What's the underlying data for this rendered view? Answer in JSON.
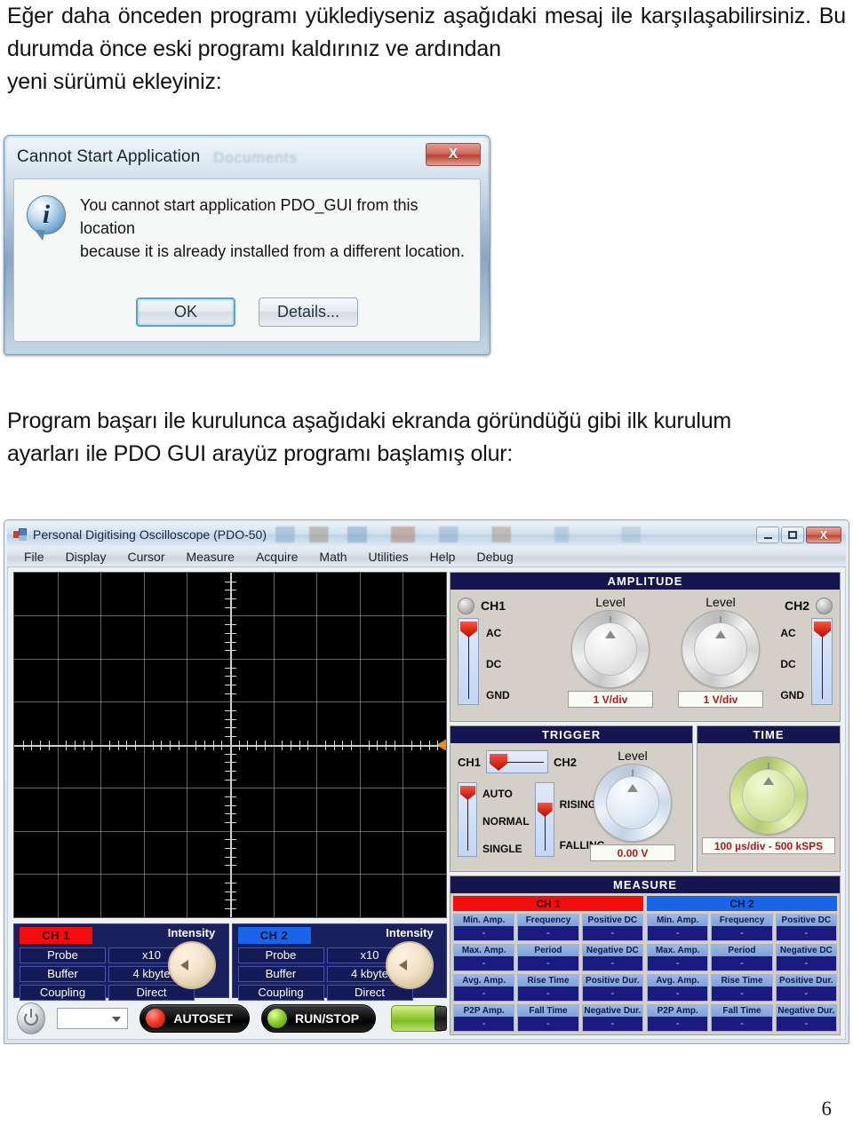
{
  "document": {
    "paragraph_1": "Eğer daha önceden programı yüklediyseniz aşağıdaki mesaj ile karşılaşabilirsiniz. Bu durumda önce eski programı kaldırınız ve ardından",
    "paragraph_1_last_line": "yeni sürümü ekleyiniz:",
    "paragraph_2": "Program başarı ile kurulunca aşağıdaki ekranda göründüğü gibi ilk kurulum",
    "paragraph_2_last_line": "ayarları ile  PDO GUI  arayüz programı başlamış olur:",
    "page_number": "6"
  },
  "error_dialog": {
    "title": "Cannot Start Application",
    "ghost_text": "Documents",
    "close_label": "X",
    "icon": "info-icon",
    "message_line_1": "You cannot start application PDO_GUI from this location",
    "message_line_2": "because it is already installed from a different location.",
    "ok_label": "OK",
    "details_label": "Details..."
  },
  "scope_window": {
    "title": "Personal Digitising Oscilloscope (PDO-50)",
    "window_buttons": {
      "minimize": "–",
      "maximize": "□",
      "close": "X"
    },
    "menu": [
      "File",
      "Display",
      "Cursor",
      "Measure",
      "Acquire",
      "Math",
      "Utilities",
      "Help",
      "Debug"
    ],
    "display": {
      "grid_columns": 10,
      "grid_rows": 8,
      "trigger_marker_color": "#f0891a",
      "background": "#000000"
    },
    "amplitude": {
      "title": "AMPLITUDE",
      "ch1_label": "CH1",
      "ch2_label": "CH2",
      "coupling_options": [
        "AC",
        "DC",
        "GND"
      ],
      "coupling_selected": "AC",
      "knob1_label": "Level",
      "knob2_label": "Level",
      "readout1": "1 V/div",
      "readout2": "1 V/div"
    },
    "trigger": {
      "title": "TRIGGER",
      "source_left": "CH1",
      "source_right": "CH2",
      "mode_options": [
        "AUTO",
        "NORMAL",
        "SINGLE"
      ],
      "mode_selected": "AUTO",
      "slope_options": [
        "RISING",
        "FALLING"
      ],
      "slope_selected": "RISING",
      "knob_label": "Level",
      "readout": "0.00 V"
    },
    "time": {
      "title": "TIME",
      "readout": "100 µs/div - 500 kSPS"
    },
    "measure": {
      "title": "MEASURE",
      "ch1_label": "CH 1",
      "ch2_label": "CH 2",
      "labels": [
        "Min. Amp.",
        "Frequency",
        "Positive DC",
        "Max. Amp.",
        "Period",
        "Negative DC",
        "Avg. Amp.",
        "Rise Time",
        "Positive Dur.",
        "P2P Amp.",
        "Fall Time",
        "Negative Dur."
      ],
      "ch1_values": [
        "-",
        "-",
        "-",
        "-",
        "-",
        "-",
        "-",
        "-",
        "-",
        "-",
        "-",
        "-"
      ],
      "ch2_values": [
        "-",
        "-",
        "-",
        "-",
        "-",
        "-",
        "-",
        "-",
        "-",
        "-",
        "-",
        "-"
      ]
    },
    "channels": [
      {
        "tag": "CH 1",
        "rows": [
          {
            "name": "Probe",
            "value": "x10"
          },
          {
            "name": "Buffer",
            "value": "4 kbyte"
          },
          {
            "name": "Coupling",
            "value": "Direct"
          }
        ],
        "intensity_label": "Intensity"
      },
      {
        "tag": "CH 2",
        "rows": [
          {
            "name": "Probe",
            "value": "x10"
          },
          {
            "name": "Buffer",
            "value": "4 kbyte"
          },
          {
            "name": "Coupling",
            "value": "Direct"
          }
        ],
        "intensity_label": "Intensity"
      }
    ],
    "bottom_bar": {
      "power_icon": "power-icon",
      "device_select_value": "",
      "autoset_label": "AUTOSET",
      "runstop_label": "RUN/STOP",
      "battery_icon": "battery-icon"
    },
    "colors": {
      "panel_header": "#151550",
      "panel_bg": "#d4d0c8",
      "ch1_red": "#f40d0d",
      "ch2_blue": "#1964e8",
      "readout_text": "#b01818",
      "measure_value_bg": "#1a1a80"
    }
  }
}
